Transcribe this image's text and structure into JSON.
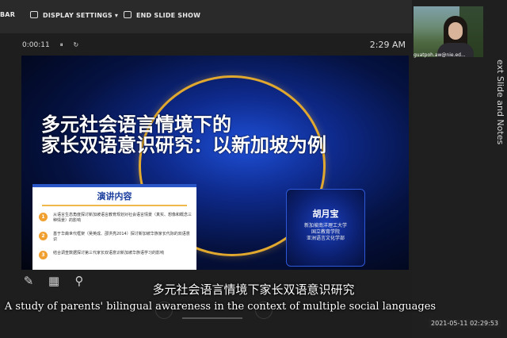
{
  "toolbar": {
    "partial_label": "BAR",
    "display_settings": "DISPLAY SETTINGS ▾",
    "end_slide_show": "END SLIDE SHOW"
  },
  "presenter": {
    "elapsed": "0:00:11",
    "pause_glyph": "⏸",
    "reset_glyph": "↻",
    "clock": "2:29 AM"
  },
  "slide": {
    "title_line1": "多元社会语言情境下的",
    "title_line2": "家长双语意识研究：以新加坡为例",
    "outline": {
      "title": "演讲内容",
      "items": [
        {
          "num": "1",
          "text": "从语言生态角度探讨新加坡语言教育规划对社会语言情景（真实、想像和概念三种情景）的影响"
        },
        {
          "num": "2",
          "text": "基于华裔世代框架（吴英成、邵洪亮2014）探讨新加坡华族家长代际的双语意识"
        },
        {
          "num": "3",
          "text": "结合调查数据探讨第三代家长双语意识新加坡华族语学习的影响"
        }
      ]
    },
    "speaker": {
      "name": "胡月宝",
      "affiliation": [
        "新加坡南洋理工大学",
        "国立教育学院",
        "亚洲语言文化学部"
      ]
    }
  },
  "webcam": {
    "name": "guatpoh.aw@nie.ed..."
  },
  "side_panel_label": "ext Slide and Notes",
  "tools": {
    "pen": "✎",
    "grid": "▦",
    "search": "⚲"
  },
  "subtitles": {
    "chinese": "多元社会语言情境下家长双语意识研究",
    "english": "A study of parents' bilingual awareness in the context of multiple social languages"
  },
  "timestamp": "2021-05-11 02:29:53"
}
